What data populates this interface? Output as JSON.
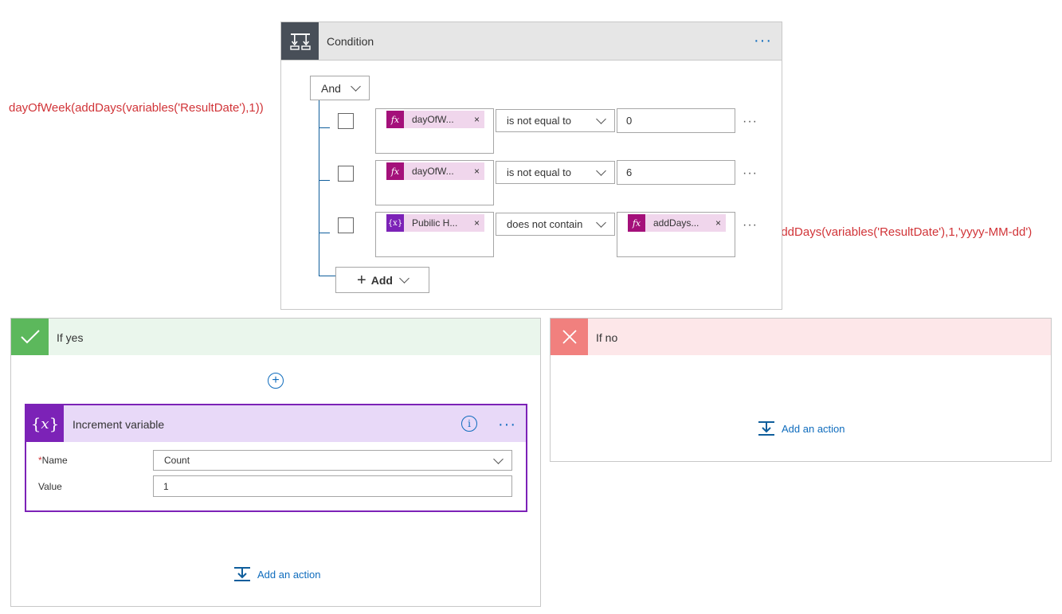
{
  "annotations": {
    "left": "dayOfWeek(addDays(variables('ResultDate'),1))",
    "right": "addDays(variables('ResultDate'),1,'yyyy-MM-dd')"
  },
  "condition": {
    "title": "Condition",
    "group_operator": "And",
    "add_label": "Add",
    "rows": [
      {
        "token_label": "dayOfW...",
        "token_icon": "fx",
        "operator": "is not equal to",
        "value": "0"
      },
      {
        "token_label": "dayOfW...",
        "token_icon": "fx",
        "operator": "is not equal to",
        "value": "6"
      },
      {
        "token_label": "Pubilic H...",
        "token_icon": "{x}",
        "operator": "does not contain",
        "value_token": "addDays..."
      }
    ],
    "token_close": "×"
  },
  "if_yes": {
    "title": "If yes",
    "add_action": "Add an action",
    "increment": {
      "title": "Increment variable",
      "name_label": "Name",
      "required_mark": "*",
      "name_value": "Count",
      "value_label": "Value",
      "value_value": "1"
    }
  },
  "if_no": {
    "title": "If no",
    "add_action": "Add an action"
  },
  "colors": {
    "accent": "#0f6cbd",
    "condition_header": "#484f58",
    "yes": "#5cb85c",
    "no": "#f1807e",
    "variable": "#7c22b7",
    "expression": "#a4107a",
    "annotation": "#d13438"
  }
}
